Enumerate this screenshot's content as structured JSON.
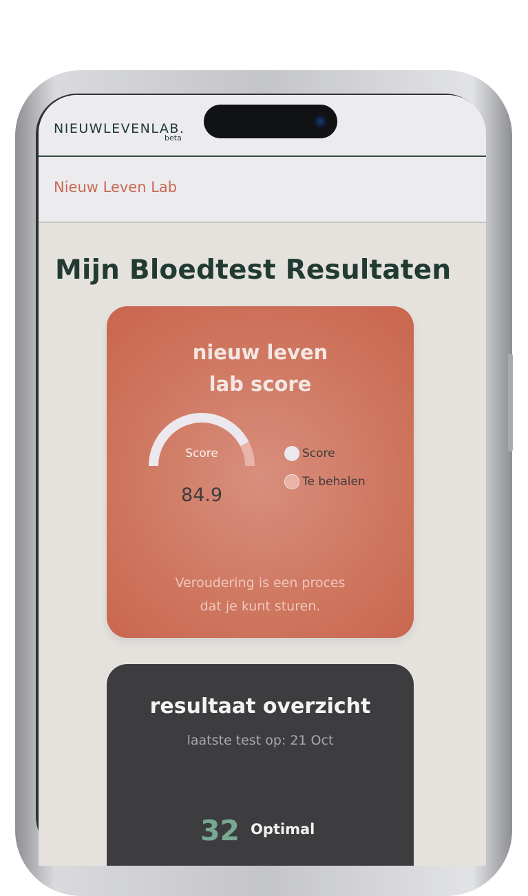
{
  "app": {
    "logo_text": "NIEUWLEVENLAB.",
    "logo_badge": "beta"
  },
  "navbar": {
    "title": "Nieuw Leven Lab"
  },
  "page": {
    "title": "Mijn Bloedtest Resultaten"
  },
  "score_card": {
    "title": "nieuw leven lab score",
    "gauge_label": "Score",
    "score_value": "84.9",
    "score_fraction": 0.849,
    "legend": [
      {
        "label": "Score",
        "color": "#ece9ee"
      },
      {
        "label": "Te behalen",
        "color": "#eab3a8"
      }
    ],
    "tagline_line1": "Veroudering is een proces",
    "tagline_line2": "dat je kunt sturen."
  },
  "overview_card": {
    "title": "resultaat overzicht",
    "subtitle": "laatste test op: 21 Oct",
    "optimal_count": "32",
    "optimal_label": "Optimal"
  },
  "colors": {
    "brand_dark": "#213b33",
    "accent": "#c86a52",
    "score_card": "#cf7760",
    "overview_card": "#3d3d40",
    "optimal_green": "#78a891"
  }
}
